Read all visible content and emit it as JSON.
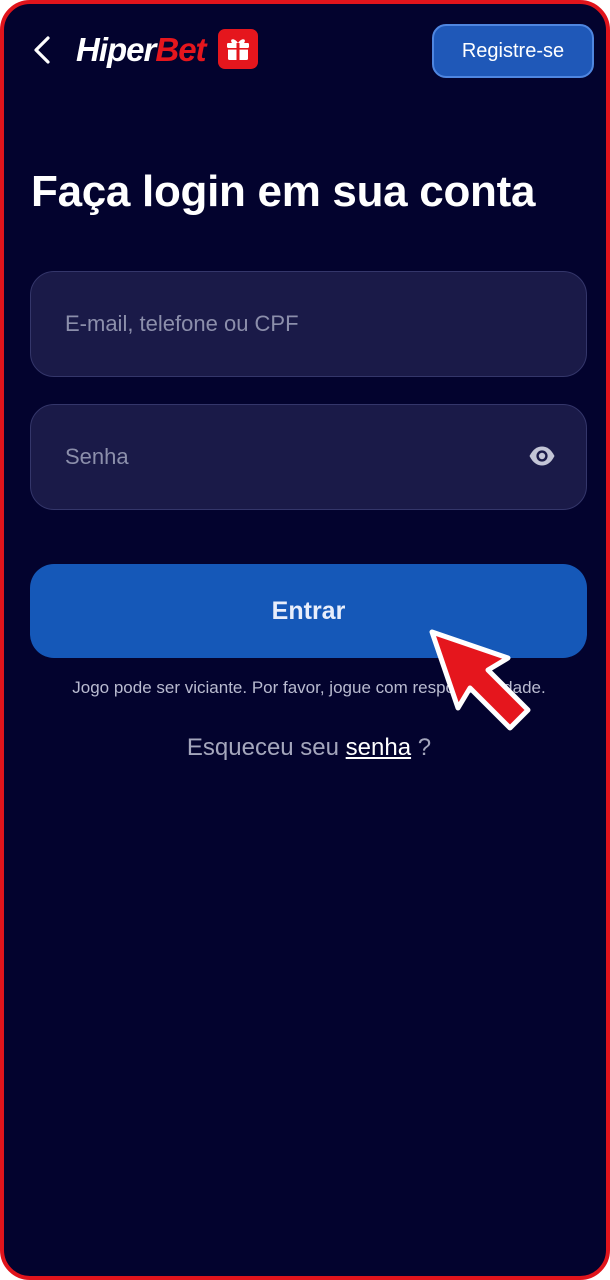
{
  "header": {
    "logo_part1": "Hiper",
    "logo_part2": "Bet",
    "register_label": "Registre-se"
  },
  "login": {
    "title": "Faça login em sua conta",
    "email_placeholder": "E-mail, telefone ou CPF",
    "password_placeholder": "Senha",
    "submit_label": "Entrar",
    "warning": "Jogo pode ser viciante. Por favor, jogue com responsabilidade.",
    "forgot_prefix": "Esqueceu seu",
    "forgot_link": "senha",
    "forgot_suffix": "?"
  },
  "colors": {
    "background": "#03032e",
    "accent_blue": "#1558b8",
    "brand_red": "#e5161d",
    "field_bg": "#1a1a48"
  },
  "icons": [
    "chevron-left-icon",
    "gift-icon",
    "eye-icon",
    "pointer-arrow-icon"
  ]
}
